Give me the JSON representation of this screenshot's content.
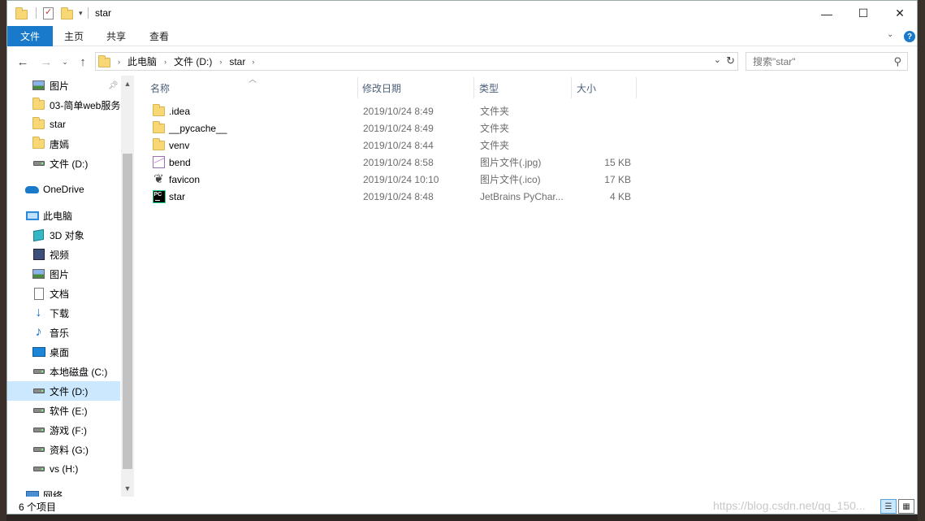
{
  "window": {
    "title": "star",
    "controls": {
      "minimize": "—",
      "maximize": "☐",
      "close": "✕"
    }
  },
  "ribbon": {
    "file_tab": "文件",
    "tabs": [
      "主页",
      "共享",
      "查看"
    ],
    "help": "?"
  },
  "address": {
    "crumbs": [
      "此电脑",
      "文件 (D:)",
      "star"
    ]
  },
  "search": {
    "placeholder": "搜索\"star\""
  },
  "nav": {
    "items": [
      {
        "label": "图片",
        "icon": "pictures-icon"
      },
      {
        "label": "03-简单web服务",
        "icon": "folder-icon"
      },
      {
        "label": "star",
        "icon": "folder-icon"
      },
      {
        "label": "唐嫣",
        "icon": "folder-icon"
      },
      {
        "label": "文件 (D:)",
        "icon": "drive-icon"
      },
      {
        "label": "OneDrive",
        "icon": "onedrive-icon"
      },
      {
        "label": "此电脑",
        "icon": "this-pc-icon"
      },
      {
        "label": "3D 对象",
        "icon": "3d-objects-icon"
      },
      {
        "label": "视频",
        "icon": "videos-icon"
      },
      {
        "label": "图片",
        "icon": "pictures-icon"
      },
      {
        "label": "文档",
        "icon": "documents-icon"
      },
      {
        "label": "下载",
        "icon": "downloads-icon"
      },
      {
        "label": "音乐",
        "icon": "music-icon"
      },
      {
        "label": "桌面",
        "icon": "desktop-icon"
      },
      {
        "label": "本地磁盘 (C:)",
        "icon": "system-drive-icon"
      },
      {
        "label": "文件 (D:)",
        "icon": "drive-icon",
        "selected": true
      },
      {
        "label": "软件 (E:)",
        "icon": "drive-icon"
      },
      {
        "label": "游戏 (F:)",
        "icon": "drive-icon"
      },
      {
        "label": "资料 (G:)",
        "icon": "drive-icon"
      },
      {
        "label": "vs (H:)",
        "icon": "drive-icon"
      },
      {
        "label": "网络",
        "icon": "network-icon"
      }
    ]
  },
  "columns": {
    "name": "名称",
    "date": "修改日期",
    "type": "类型",
    "size": "大小"
  },
  "files": [
    {
      "name": ".idea",
      "date": "2019/10/24 8:49",
      "type": "文件夹",
      "size": "",
      "icon": "folder-icon"
    },
    {
      "name": "__pycache__",
      "date": "2019/10/24 8:49",
      "type": "文件夹",
      "size": "",
      "icon": "folder-icon"
    },
    {
      "name": "venv",
      "date": "2019/10/24 8:44",
      "type": "文件夹",
      "size": "",
      "icon": "folder-icon"
    },
    {
      "name": "bend",
      "date": "2019/10/24 8:58",
      "type": "图片文件(.jpg)",
      "size": "15 KB",
      "icon": "image-file-icon"
    },
    {
      "name": "favicon",
      "date": "2019/10/24 10:10",
      "type": "图片文件(.ico)",
      "size": "17 KB",
      "icon": "ico-file-icon"
    },
    {
      "name": "star",
      "date": "2019/10/24 8:48",
      "type": "JetBrains PyChar...",
      "size": "4 KB",
      "icon": "pycharm-icon"
    }
  ],
  "status": {
    "count": "6 个项目"
  },
  "watermark": "https://blog.csdn.net/qq_150..."
}
